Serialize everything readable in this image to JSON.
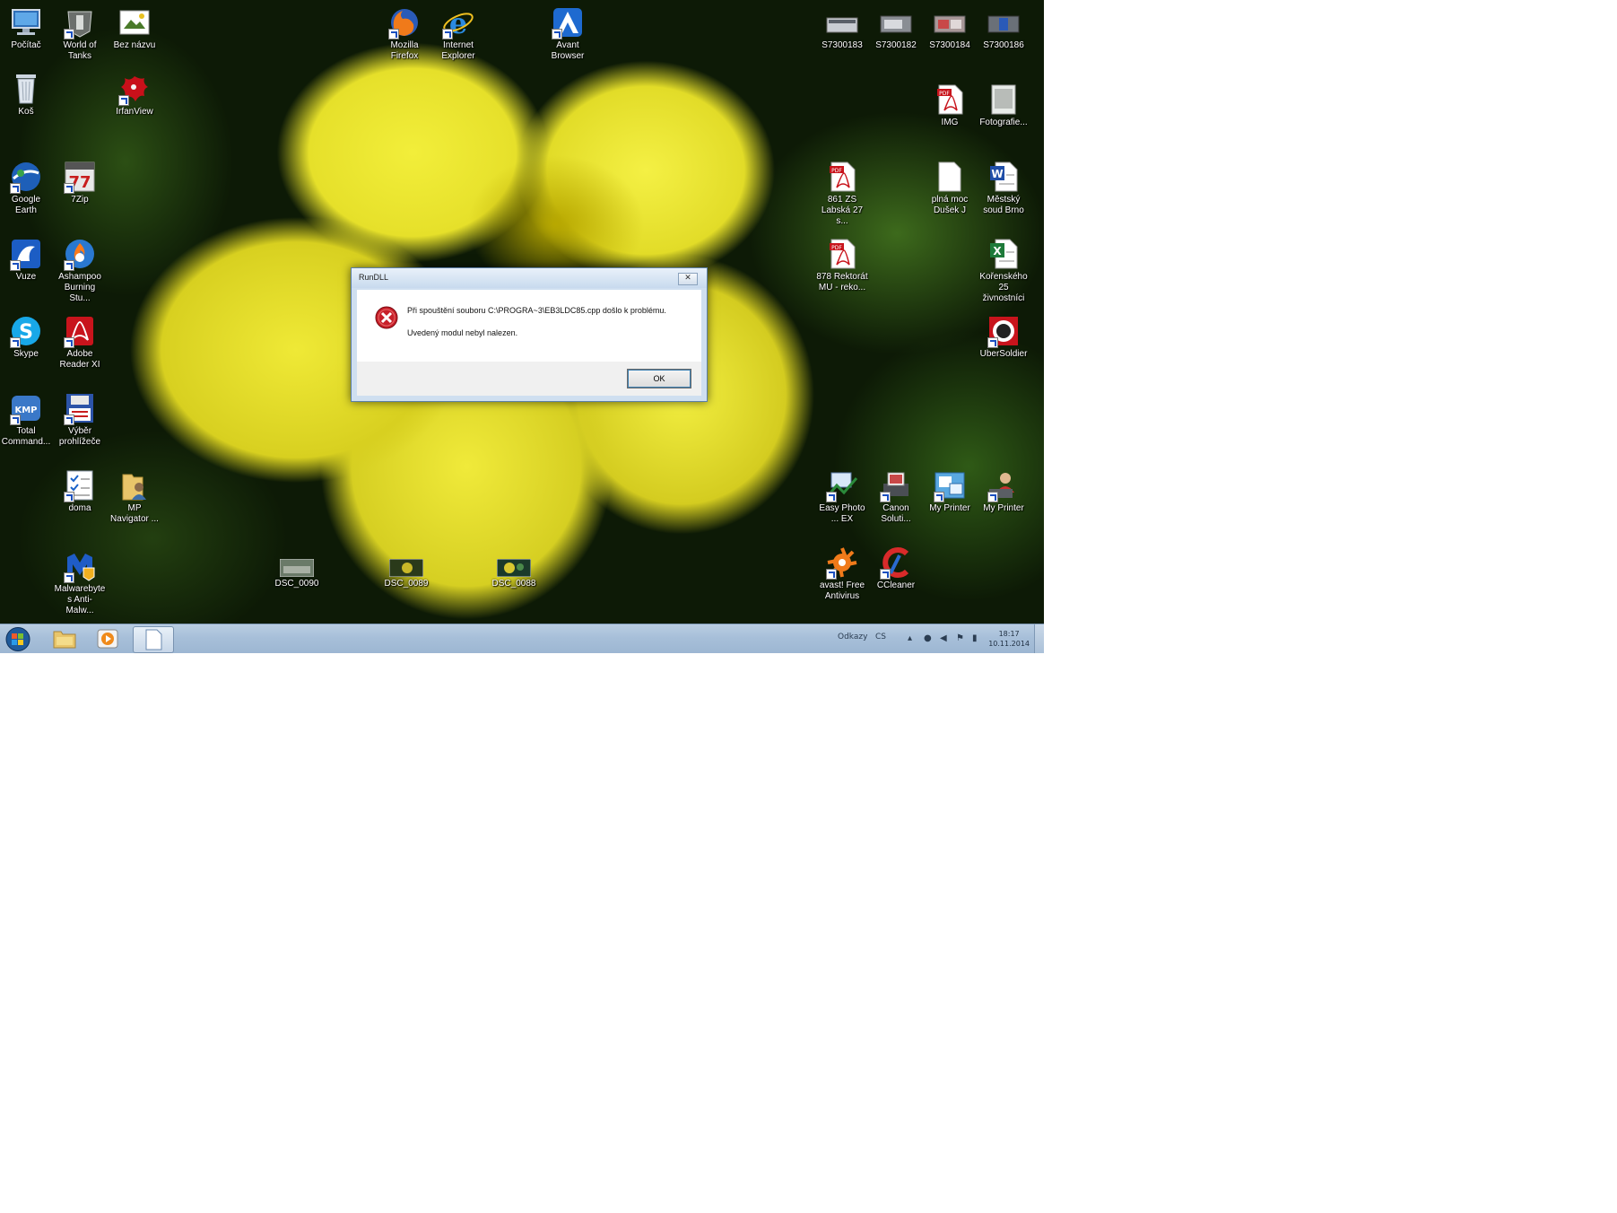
{
  "desktop_icons": [
    {
      "id": "pocitac",
      "label": "Počítač",
      "icon": "computer-icon"
    },
    {
      "id": "wot",
      "label": "World of Tanks",
      "icon": "tank-helmet-icon"
    },
    {
      "id": "beznazvu",
      "label": "Bez názvu",
      "icon": "image-file-icon"
    },
    {
      "id": "firefox",
      "label": "Mozilla Firefox",
      "icon": "firefox-icon"
    },
    {
      "id": "ie",
      "label": "Internet Explorer",
      "icon": "internet-explorer-icon"
    },
    {
      "id": "avant",
      "label": "Avant Browser",
      "icon": "avant-browser-icon"
    },
    {
      "id": "s1",
      "label": "S7300183",
      "icon": "scanner-icon"
    },
    {
      "id": "s2",
      "label": "S7300182",
      "icon": "scanner-icon"
    },
    {
      "id": "s3",
      "label": "S7300184",
      "icon": "scanner-icon"
    },
    {
      "id": "s4",
      "label": "S7300186",
      "icon": "scanner-icon"
    },
    {
      "id": "kos",
      "label": "Koš",
      "icon": "recycle-bin-icon"
    },
    {
      "id": "irfan",
      "label": "IrfanView",
      "icon": "irfanview-icon"
    },
    {
      "id": "img",
      "label": "IMG",
      "icon": "pdf-file-icon"
    },
    {
      "id": "foto",
      "label": "Fotografie...",
      "icon": "image-file-icon"
    },
    {
      "id": "gearth",
      "label": "Google Earth",
      "icon": "google-earth-icon"
    },
    {
      "id": "7zip",
      "label": "7Zip",
      "icon": "7zip-icon"
    },
    {
      "id": "zs861",
      "label": "861 ZS Labská 27 s...",
      "icon": "pdf-file-icon"
    },
    {
      "id": "plnamoc",
      "label": "plná moc Dušek J",
      "icon": "text-file-icon"
    },
    {
      "id": "mestsky",
      "label": "Městský soud Brno",
      "icon": "word-file-icon"
    },
    {
      "id": "vuze",
      "label": "Vuze",
      "icon": "vuze-icon"
    },
    {
      "id": "ashampoo",
      "label": "Ashampoo Burning Stu...",
      "icon": "burning-studio-icon"
    },
    {
      "id": "r878",
      "label": "878 Rektorát MU - reko...",
      "icon": "pdf-file-icon"
    },
    {
      "id": "korenske",
      "label": "Kořenského 25 živnostníci",
      "icon": "excel-file-icon"
    },
    {
      "id": "skype",
      "label": "Skype",
      "icon": "skype-icon"
    },
    {
      "id": "acrobat",
      "label": "Adobe Reader XI",
      "icon": "adobe-reader-icon"
    },
    {
      "id": "uber",
      "label": "UberSoldier",
      "icon": "ubersoldier-icon"
    },
    {
      "id": "kmp",
      "label": "KMPlayer",
      "icon": "kmplayer-icon"
    },
    {
      "id": "tc",
      "label": "Total Command...",
      "icon": "floppy-icon"
    },
    {
      "id": "vyber",
      "label": "Výběr prohlížeče",
      "icon": "checklist-icon"
    },
    {
      "id": "doma",
      "label": "doma",
      "icon": "user-folder-icon"
    },
    {
      "id": "mpnav",
      "label": "MP Navigator ...",
      "icon": "mp-navigator-icon"
    },
    {
      "id": "easyphoto",
      "label": "Easy Photo ... EX",
      "icon": "printer-photo-icon"
    },
    {
      "id": "canon",
      "label": "Canon Soluti...",
      "icon": "canon-icon"
    },
    {
      "id": "myprinter",
      "label": "My Printer",
      "icon": "my-printer-icon"
    },
    {
      "id": "malware",
      "label": "Malwarebytes Anti-Malw...",
      "icon": "malwarebytes-icon"
    },
    {
      "id": "dsc90",
      "label": "DSC_0090",
      "icon": "photo-thumbnail-icon"
    },
    {
      "id": "dsc89",
      "label": "DSC_0089",
      "icon": "photo-thumbnail-icon"
    },
    {
      "id": "dsc88",
      "label": "DSC_0088",
      "icon": "photo-thumbnail-icon"
    },
    {
      "id": "avast",
      "label": "avast! Free Antivirus",
      "icon": "avast-icon"
    },
    {
      "id": "ccleaner",
      "label": "CCleaner",
      "icon": "ccleaner-icon"
    }
  ],
  "dialog": {
    "title": "RunDLL",
    "close_glyph": "✕",
    "message_line1": "Při spouštění souboru C:\\PROGRA~3\\EB3LDC85.cpp došlo k problému.",
    "message_line2": "Uvedený modul nebyl nalezen.",
    "ok_label": "OK"
  },
  "taskbar": {
    "start": "start-orb-icon",
    "pinned": [
      "explorer-folder-icon",
      "media-player-icon",
      "blank-document-icon"
    ],
    "tray": {
      "keyboard_label": "Odkazy",
      "language": "CS",
      "time": "18:17",
      "date": "10.11.2014"
    }
  },
  "colors": {
    "dialog_bg": "#cfdff0",
    "taskbar": "#a7bfd9",
    "error_red": "#c8202a",
    "flower_yellow": "#efe936"
  }
}
